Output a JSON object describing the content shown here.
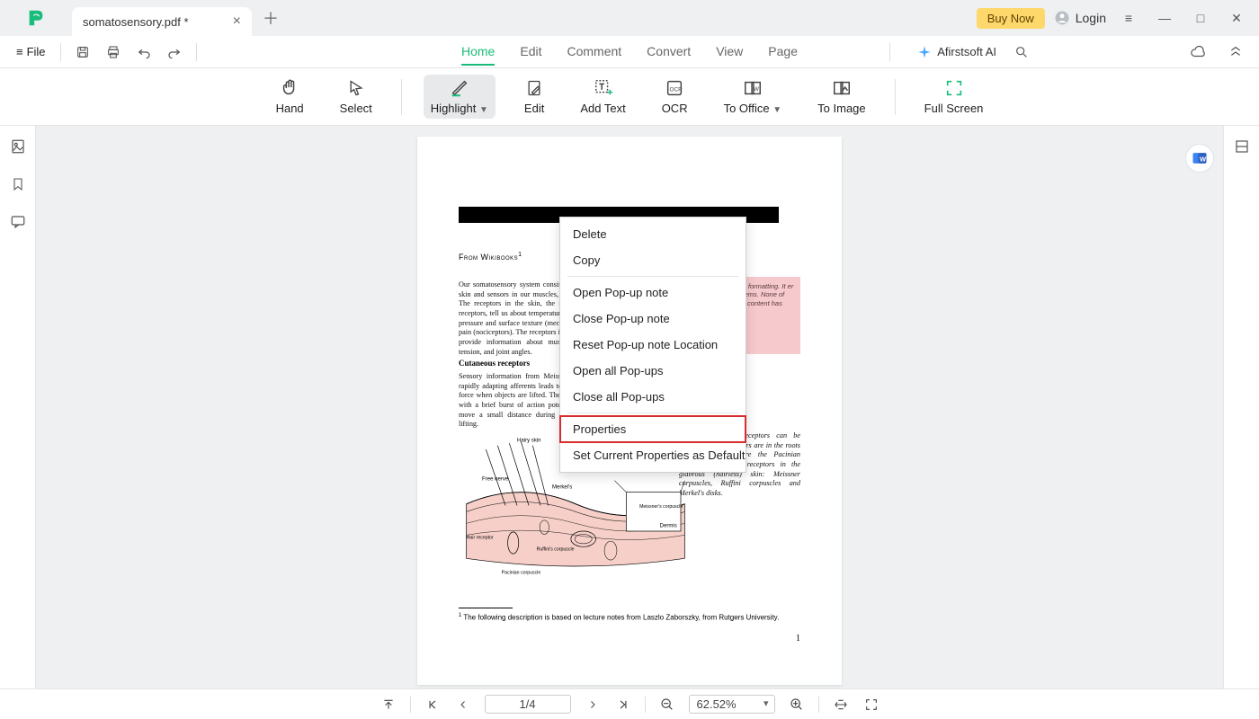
{
  "titlebar": {
    "tab_title": "somatosensory.pdf *",
    "buy_now": "Buy Now",
    "login": "Login"
  },
  "menubar": {
    "file": "File",
    "tabs": {
      "home": "Home",
      "edit": "Edit",
      "comment": "Comment",
      "convert": "Convert",
      "view": "View",
      "page": "Page"
    },
    "ai_label": "Afirstsoft AI"
  },
  "toolbar": {
    "hand": "Hand",
    "select": "Select",
    "highlight": "Highlight",
    "edit": "Edit",
    "add_text": "Add Text",
    "ocr": "OCR",
    "to_office": "To Office",
    "to_image": "To Image",
    "full_screen": "Full Screen"
  },
  "context_menu": {
    "delete": "Delete",
    "copy": "Copy",
    "open_popup": "Open Pop-up note",
    "close_popup": "Close Pop-up note",
    "reset_popup": "Reset Pop-up note Location",
    "open_all": "Open all Pop-ups",
    "close_all": "Close all Pop-ups",
    "properties": "Properties",
    "set_default": "Set Current Properties as Default"
  },
  "document": {
    "from_wikibooks": "From Wikibooks",
    "para1": "Our somatosensory system consists of sensors in the skin and sensors in our muscles, tendons, and joints. The receptors in the skin, the so called cutaneous receptors, tell us about temperature (thermoreceptors), pressure and surface texture (mechano receptors), and pain (nociceptors). The receptors in muscles and joints provide information about muscle length, muscle tension, and joint angles.",
    "pinkbox": "document to based formatting. It er from a Wikibook stems. None of the changed in this content has been",
    "h_cutaneous": "Cutaneous receptors",
    "para2": "Sensory information from Meissner corpuscles and rapidly adapting afferents leads to adjustment of grip force when objects are lifted. These afferents respond with a brief burst of action potentials when objects move a small distance during the early stages of lifting.",
    "diagram_labels": {
      "hairy": "Hairy skin",
      "freenerve": "Free nerve",
      "merkel": "Merkel's",
      "meissner": "Meissner's corpuscle",
      "dermis": "Dermis",
      "ruffini": "Ruffini's corpuscle",
      "hairrec": "Hair receptor",
      "pacinian": "Pacinian corpuscle"
    },
    "rightcol": "s in the human receptors can be encapsulated. Receptors are in the roots of the receptors are the Pacinian corpuscles and the receptors in the glabrous (hairless) skin: Meissner corpuscles, Ruffini corpuscles and Merkel's disks.",
    "footnote": "The following description is based on lecture notes from Laszlo Zaborszky, from Rutgers University.",
    "page_number": "1"
  },
  "statusbar": {
    "page": "1/4",
    "zoom": "62.52%"
  }
}
